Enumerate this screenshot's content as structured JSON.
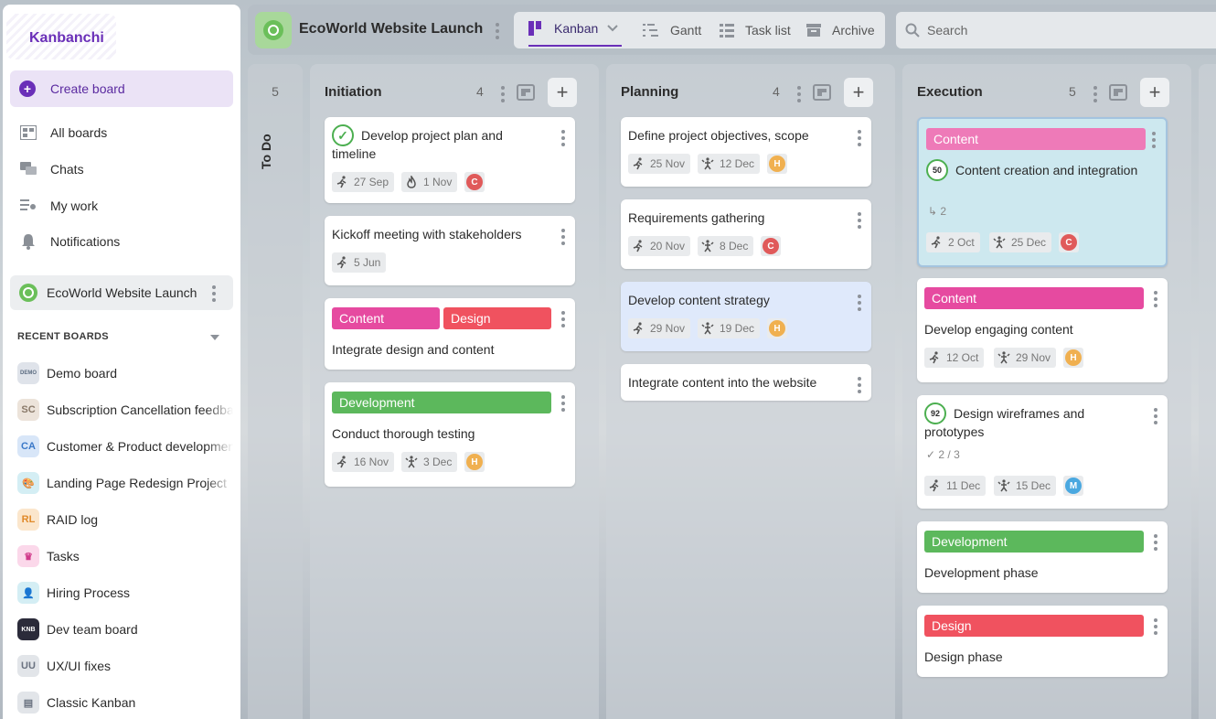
{
  "app": {
    "name": "Kanbanchi"
  },
  "sidebar": {
    "create_label": "Create board",
    "nav": [
      {
        "label": "All boards",
        "icon": "boards-icon"
      },
      {
        "label": "Chats",
        "icon": "chat-icon"
      },
      {
        "label": "My work",
        "icon": "my-work-icon"
      },
      {
        "label": "Notifications",
        "icon": "bell-icon"
      }
    ],
    "current_board": "EcoWorld Website Launch",
    "recent_header": "RECENT BOARDS",
    "recent": [
      {
        "label": "Demo board",
        "badge": "DEMO",
        "color": "#5b6b80",
        "bg": "#dfe3ea"
      },
      {
        "label": "Subscription Cancellation feedback",
        "badge": "SC",
        "color": "#8a7a6a",
        "bg": "#ece3da"
      },
      {
        "label": "Customer & Product development",
        "badge": "CA",
        "color": "#3a78c8",
        "bg": "#d8e6f8"
      },
      {
        "label": "Landing Page Redesign Project",
        "badge": "🎨",
        "color": "#2a9ab8",
        "bg": "#d4eef4"
      },
      {
        "label": "RAID log",
        "badge": "RL",
        "color": "#e08a2a",
        "bg": "#fbe6cc"
      },
      {
        "label": "Tasks",
        "badge": "♛",
        "color": "#d03a8a",
        "bg": "#fbd8ea"
      },
      {
        "label": "Hiring Process",
        "badge": "👤",
        "color": "#2a9ab8",
        "bg": "#d4eef4"
      },
      {
        "label": "Dev team board",
        "badge": "KNB",
        "color": "#ffffff",
        "bg": "#2b2b3a"
      },
      {
        "label": "UX/UI fixes",
        "badge": "UU",
        "color": "#6a7280",
        "bg": "#e2e5e9"
      },
      {
        "label": "Classic Kanban",
        "badge": "▤",
        "color": "#6a7280",
        "bg": "#e2e5e9"
      }
    ]
  },
  "topbar": {
    "title": "EcoWorld Website Launch",
    "views": [
      {
        "label": "Kanban",
        "icon": "kanban-icon"
      },
      {
        "label": "Gantt",
        "icon": "gantt-icon"
      },
      {
        "label": "Task list",
        "icon": "list-icon"
      },
      {
        "label": "Archive",
        "icon": "archive-icon"
      }
    ],
    "search_placeholder": "Search"
  },
  "todo": {
    "count": "5",
    "label": "To Do"
  },
  "columns": [
    {
      "title": "Initiation",
      "count": "4",
      "cards": [
        {
          "title": "Develop project plan and timeline",
          "done": true,
          "chips": [
            {
              "icon": "start",
              "text": "27 Sep"
            },
            {
              "icon": "fire",
              "text": "1 Nov"
            }
          ],
          "avatar": {
            "letter": "C",
            "color": "#e05a5a"
          }
        },
        {
          "title": "Kickoff meeting with stakeholders",
          "chips": [
            {
              "icon": "start",
              "text": "5 Jun"
            }
          ]
        },
        {
          "title": "Integrate design and content",
          "tags": [
            {
              "text": "Content",
              "color": "#e64aa0"
            },
            {
              "text": "Design",
              "color": "#f0525f"
            }
          ]
        },
        {
          "title": "Conduct thorough testing",
          "tags": [
            {
              "text": "Development",
              "color": "#5cb85c"
            }
          ],
          "chips": [
            {
              "icon": "start",
              "text": "16 Nov"
            },
            {
              "icon": "due",
              "text": "3 Dec"
            }
          ],
          "avatar": {
            "letter": "H",
            "color": "#f0b050"
          }
        }
      ]
    },
    {
      "title": "Planning",
      "count": "4",
      "cards": [
        {
          "title": "Define project objectives, scope",
          "chips": [
            {
              "icon": "start",
              "text": "25 Nov"
            },
            {
              "icon": "due",
              "text": "12 Dec"
            }
          ],
          "avatar": {
            "letter": "H",
            "color": "#f0b050"
          }
        },
        {
          "title": "Requirements gathering",
          "chips": [
            {
              "icon": "start",
              "text": "20 Nov"
            },
            {
              "icon": "due",
              "text": "8 Dec"
            }
          ],
          "avatar": {
            "letter": "C",
            "color": "#e05a5a"
          }
        },
        {
          "title": "Develop content strategy",
          "chips": [
            {
              "icon": "start",
              "text": "29 Nov"
            },
            {
              "icon": "due",
              "text": "19 Dec"
            }
          ],
          "avatar": {
            "letter": "H",
            "color": "#f0b050"
          }
        },
        {
          "title": "Integrate content into the website"
        }
      ]
    },
    {
      "title": "Execution",
      "count": "5",
      "cards": [
        {
          "title": "Content creation and integration",
          "progress": "50",
          "subcards": "2",
          "tags": [
            {
              "text": "Content",
              "color": "#ee7ab8"
            }
          ],
          "chips": [
            {
              "icon": "start",
              "text": "2 Oct"
            },
            {
              "icon": "due",
              "text": "25 Dec"
            }
          ],
          "avatar": {
            "letter": "C",
            "color": "#e05a5a"
          }
        },
        {
          "title": "Develop engaging content",
          "tags": [
            {
              "text": "Content",
              "color": "#e64aa0"
            }
          ],
          "chips": [
            {
              "icon": "start",
              "text": "12 Oct"
            },
            {
              "icon": "due",
              "text": "29 Nov"
            }
          ],
          "avatar": {
            "letter": "H",
            "color": "#f0b050"
          }
        },
        {
          "title": "Design wireframes and prototypes",
          "progress": "92",
          "checklist": "2 / 3",
          "chips": [
            {
              "icon": "start",
              "text": "11 Dec"
            },
            {
              "icon": "due",
              "text": "15 Dec"
            }
          ],
          "avatar": {
            "letter": "M",
            "color": "#4aa8e0"
          }
        },
        {
          "title": "Development phase",
          "tags": [
            {
              "text": "Development",
              "color": "#5cb85c"
            }
          ]
        },
        {
          "title": "Design phase",
          "tags": [
            {
              "text": "Design",
              "color": "#f0525f"
            }
          ]
        }
      ]
    }
  ]
}
